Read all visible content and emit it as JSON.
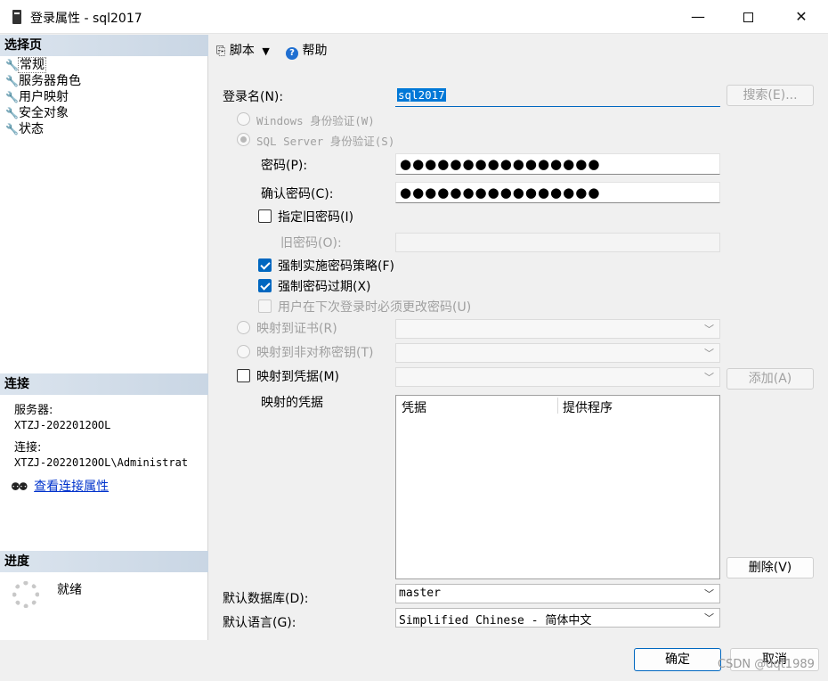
{
  "window": {
    "title": "登录属性 - sql2017",
    "min_glyph": "—",
    "close_glyph": "✕"
  },
  "left": {
    "pages_header": "选择页",
    "pages": [
      {
        "label": "常规",
        "active": true
      },
      {
        "label": "服务器角色"
      },
      {
        "label": "用户映射"
      },
      {
        "label": "安全对象"
      },
      {
        "label": "状态"
      }
    ],
    "connection_header": "连接",
    "server_label": "服务器:",
    "server_value": "XTZJ-20220120OL",
    "connection_label": "连接:",
    "connection_value": "XTZJ-20220120OL\\Administrat",
    "view_connection_link": "查看连接属性",
    "progress_header": "进度",
    "progress_status": "就绪"
  },
  "toolbar": {
    "script_label": "脚本",
    "help_label": "帮助"
  },
  "form": {
    "login_name_label": "登录名(N):",
    "login_name_value": "sql2017",
    "search_button": "搜索(E)...",
    "windows_auth": "Windows 身份验证(W)",
    "sql_auth": "SQL Server 身份验证(S)",
    "password_label": "密码(P):",
    "password_mask": "●●●●●●●●●●●●●●●●",
    "confirm_label": "确认密码(C):",
    "confirm_mask": "●●●●●●●●●●●●●●●●",
    "specify_old": "指定旧密码(I)",
    "old_password_label": "旧密码(O):",
    "enforce_policy": "强制实施密码策略(F)",
    "enforce_expiration": "强制密码过期(X)",
    "must_change": "用户在下次登录时必须更改密码(U)",
    "map_cert": "映射到证书(R)",
    "map_asym": "映射到非对称密钥(T)",
    "map_cred": "映射到凭据(M)",
    "add_button": "添加(A)",
    "mapped_creds_label": "映射的凭据",
    "cred_col1": "凭据",
    "cred_col2": "提供程序",
    "delete_button": "删除(V)",
    "default_db_label": "默认数据库(D):",
    "default_db_value": "master",
    "default_lang_label": "默认语言(G):",
    "default_lang_value": "Simplified Chinese - 简体中文"
  },
  "footer": {
    "ok_button": "确定",
    "cancel_button": "取消",
    "watermark": "CSDN @dqt1989"
  },
  "colors": {
    "accent": "#0067c0",
    "selection": "#0078d7",
    "link": "#0033cc"
  }
}
